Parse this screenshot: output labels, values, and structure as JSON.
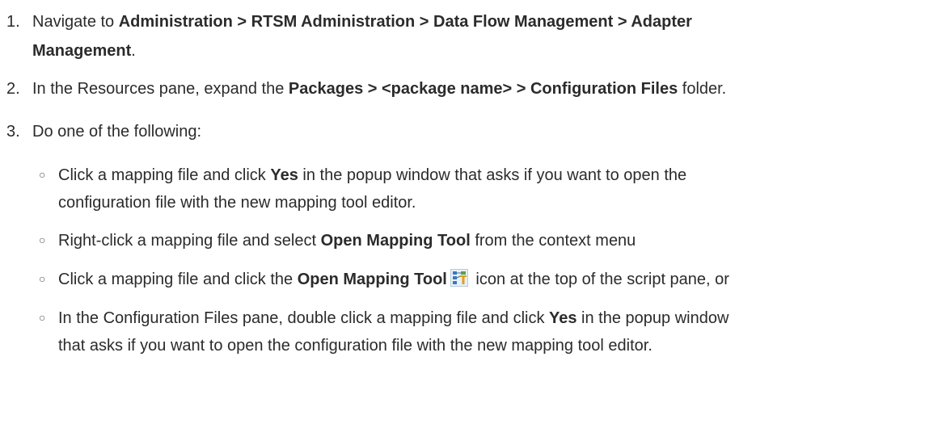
{
  "steps": [
    {
      "number": "1.",
      "line1": {
        "prefix": "Navigate to ",
        "bold": "Administration > RTSM Administration > Data Flow Management > Adapter"
      },
      "line2": {
        "bold": "Management",
        "suffix": "."
      }
    },
    {
      "number": "2.",
      "prefix": "In the Resources pane, expand the ",
      "bold": "Packages > <package name> > Configuration Files",
      "suffix": " folder."
    },
    {
      "number": "3.",
      "text": "Do one of the following:"
    }
  ],
  "options": [
    {
      "bullet": "○",
      "line1": {
        "prefix": "Click a mapping file and click ",
        "bold": "Yes",
        "suffix": " in the popup window that asks if you want to open the"
      },
      "line2": "configuration file with the new mapping tool editor."
    },
    {
      "bullet": "○",
      "prefix": "Right-click a mapping file and select ",
      "bold": "Open Mapping Tool",
      "suffix": " from the context menu"
    },
    {
      "bullet": "○",
      "prefix": "Click a mapping file and click the ",
      "bold": "Open Mapping Tool",
      "icon": "open-mapping-tool-icon",
      "suffix": " icon at the top of the script pane, or"
    },
    {
      "bullet": "○",
      "line1": {
        "prefix": "In the Configuration Files pane, double click a mapping file and click ",
        "bold": "Yes",
        "suffix": " in the popup window"
      },
      "line2": "that asks if you want to open the configuration file with the new mapping tool editor."
    }
  ]
}
